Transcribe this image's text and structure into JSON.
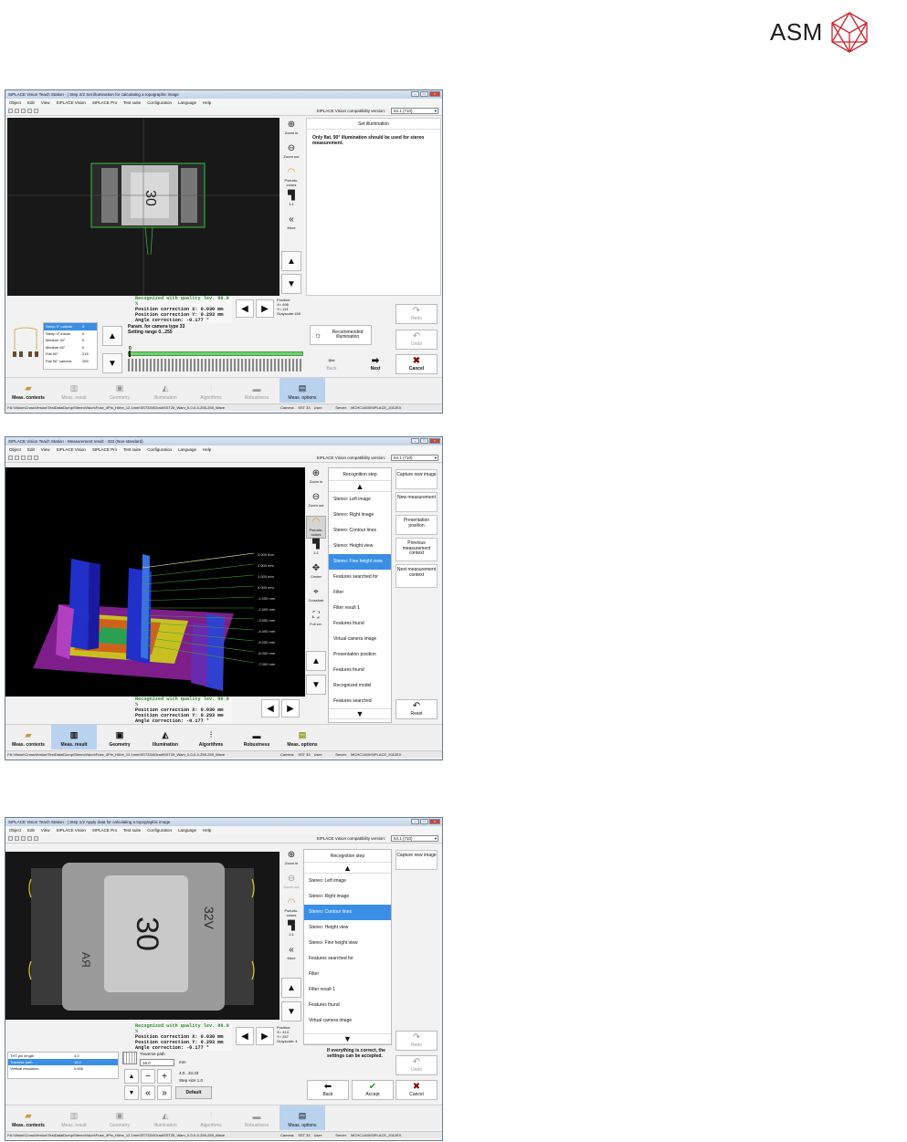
{
  "logo": {
    "text": "ASM"
  },
  "common": {
    "menu": [
      "Object",
      "Edit",
      "View",
      "SIPLACE Vision",
      "SIPLACE Pro",
      "Test suite",
      "Configuration",
      "Language",
      "Help"
    ],
    "compat_label": "SIPLACE Vision compatibility version:",
    "compat_value": "54.1 (710)",
    "tools": {
      "zoom_in": "Zoom in",
      "zoom_out": "Zoom out",
      "pseudo": "Pseudo-colors",
      "one": "1:1",
      "more": "More",
      "center": "Center",
      "crosshair": "Crosshair",
      "fullscr": "Full scr."
    },
    "quality": {
      "recognized": "Recognized with quality lev.   86.0 %",
      "posx": "Position correction X:      0.030 mm",
      "posy": "Position correction Y:      0.293 mm",
      "angle": "Angle correction:          -0.177 °"
    },
    "tabs": [
      "Meas. contexts",
      "Meas. result",
      "Geometry",
      "Illumination",
      "Algorithms",
      "Robustness",
      "Meas. options"
    ],
    "status": {
      "path": "I*A:\\Vision\\CrossVersion\\TestData\\Dump\\StereoVision\\Fuse_4Pin_Höhe_12.1mm\\SST33\\0Grad\\SST25_Wam_0-0-0-0-255-255_Wave",
      "camera_label": "Camera:",
      "camera": "SST 33",
      "user_label": "User:",
      "server_label": "Server:",
      "server": "MCHC1400\\SIPLACE_2012EX"
    },
    "buttons": {
      "redo": "Redo",
      "undo": "Undo",
      "back": "Back",
      "next": "Next",
      "cancel": "Cancel",
      "accept": "Accept",
      "reset": "Reset"
    }
  },
  "win1": {
    "title": "SIPLACE Vision Teach Station -  | Step 2/2 Set illumination for calculating a topographic image",
    "panel_title": "Set illumination",
    "panel_text": "Only flat, 90° illumination should be used for stereo measurement.",
    "position": {
      "label": "Position:",
      "x": "X= 496",
      "y": "Y= 114",
      "gray": "Grayscale:158"
    },
    "lamps": [
      {
        "name": "Steep 0° outside",
        "v": "0"
      },
      {
        "name": "Steep 0° inside",
        "v": "0"
      },
      {
        "name": "Medium 30°",
        "v": "0"
      },
      {
        "name": "Medium 60°",
        "v": "0"
      },
      {
        "name": "Flat 90°",
        "v": "215"
      },
      {
        "name": "Flat 90° camera",
        "v": "255"
      }
    ],
    "param_title": "Param. for camera type 33",
    "param_range": "Setting range 0...255",
    "slider": {
      "value": "0",
      "level": 0.0
    },
    "recommended": "Recommended illumination"
  },
  "win2": {
    "title": "SIPLACE Vision Teach Station - Measurement result - 333 (Non-standard)",
    "step_head": "Recognition step",
    "steps": [
      "Stereo: Left image",
      "Stereo: Right image",
      "Stereo: Contour lines",
      "Stereo: Height view",
      "Stereo: Fine height view",
      "Features searched for",
      "Filter",
      "Filter result  1",
      "Features found",
      "Virtual camera image",
      "Presentation position",
      "Features found",
      "Recognized model",
      "Features searched"
    ],
    "selected": 4,
    "side": [
      "Capture new image",
      "New measurement",
      "Presentation position",
      "Previous measurement context",
      "Next measurement context"
    ],
    "levels": [
      "3.000 mm",
      "2.000 mm",
      "1.000 mm",
      "0.000 mm",
      "-1.000 mm",
      "-2.000 mm",
      "-3.000 mm",
      "-4.000 mm",
      "-5.000 mm",
      "-6.000 mm",
      "-7.000 mm"
    ]
  },
  "win3": {
    "title": "SIPLACE Vision Teach Station -  | Step 1/2 Apply data for calculating a topographic image",
    "step_head": "Recognition step",
    "steps": [
      "Stereo: Left image",
      "Stereo: Right image",
      "Stereo: Contour lines",
      "Stereo: Height view",
      "Stereo: Fine height view",
      "Features searched for",
      "Filter",
      "Filter result  1",
      "Features found",
      "Virtual camera image"
    ],
    "selected": 2,
    "side": [
      "Capture new image"
    ],
    "position": {
      "label": "Position:",
      "x": "X= 414",
      "y": "Y= 347",
      "gray": "Grayscale: 4"
    },
    "params": [
      {
        "name": "THT pin length",
        "v": "4.0"
      },
      {
        "name": "Traverse path",
        "v": "16.0"
      },
      {
        "name": "Vertical resolution",
        "v": "0.836"
      }
    ],
    "edit_label": "Traverse path",
    "edit_value": "16.0",
    "unit": "mm",
    "range": "4.0...33.33",
    "stepsize": "Step size 1.0",
    "default": "Default",
    "info": "If everything is correct, the settings can be accepted."
  }
}
